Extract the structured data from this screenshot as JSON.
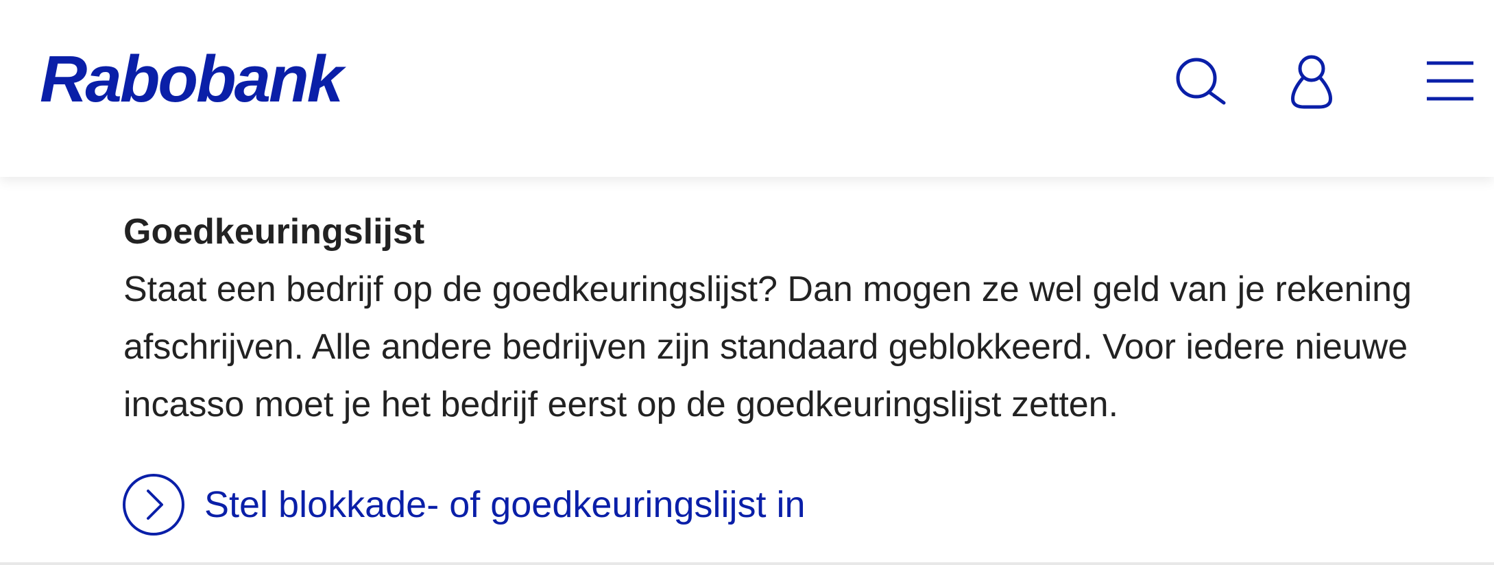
{
  "header": {
    "logo_text": "Rabobank",
    "icons": {
      "search": "search-icon",
      "account": "user-icon",
      "menu": "hamburger-menu-icon"
    }
  },
  "content": {
    "title": "Goedkeuringslijst",
    "body": "Staat een bedrijf op de goedkeuringslijst? Dan mogen ze wel geld van je rekening afschrijven. Alle andere bedrijven zijn standaard geblokkeerd. Voor iedere nieuwe incasso moet je het bedrijf eerst op de goedkeuringslijst zetten.",
    "cta_label": "Stel blokkade- of goedkeuringslijst in",
    "cta_icon": "chevron-right-circle-icon"
  },
  "colors": {
    "brand_blue": "#0a1fa8",
    "text": "#222222",
    "background": "#ffffff"
  }
}
